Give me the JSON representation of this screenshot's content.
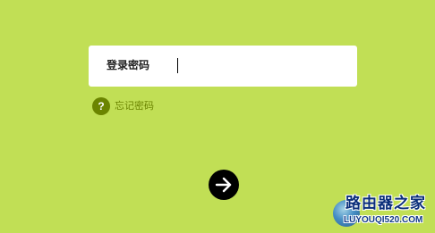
{
  "colors": {
    "background": "#c1df55",
    "input_background": "#ffffff",
    "help_accent": "#6b8400",
    "button": "#000000",
    "button_icon": "#ffffff"
  },
  "login": {
    "label": "登录密码",
    "value": ""
  },
  "forgot": {
    "icon_glyph": "?",
    "icon": "question-circle-icon",
    "label": "忘记密码"
  },
  "submit": {
    "icon": "arrow-right-icon"
  },
  "watermark": {
    "title": "路由器之家",
    "url": "LUYOUQI520.COM"
  }
}
